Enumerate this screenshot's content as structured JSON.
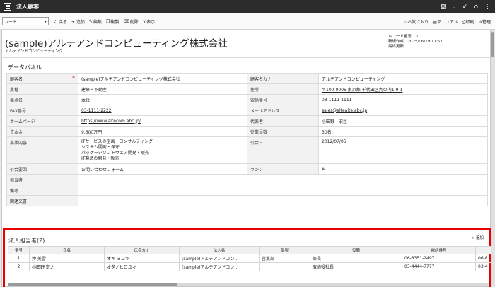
{
  "app": {
    "title": "法人顧客"
  },
  "top_icons": [
    "book-icon",
    "bell-icon",
    "check-icon",
    "home-icon",
    "more-icon"
  ],
  "toolbar": {
    "view_select": "カード",
    "back": "く 戻る",
    "add": "+ 追加",
    "edit": "編集",
    "copy": "複製",
    "delete": "削除",
    "show": "表示",
    "favorite": "お気に入り",
    "manual": "マニュアル",
    "print": "印刷",
    "admin": "管理"
  },
  "record": {
    "name": "(sample)アルテアンドコンピューティング株式会社",
    "kana": "アルテアンドコンピューティング",
    "meta_number": "レコード番号：3",
    "meta_created": "新規作成：2025/06/19 17:57",
    "meta_updated": "最終更新："
  },
  "panel": {
    "title": "データパネル",
    "rows": [
      [
        "顧客名",
        "(sample)アルテアンドコンピューティング株式会社",
        "顧客名カナ",
        "アルテアンドコンピューティング"
      ],
      [
        "業種",
        "建築・不動産",
        "住所",
        "〒100-0005 東京都 千代田区丸の内1-9-1"
      ],
      [
        "拠点名",
        "本社",
        "電話番号",
        "03-1111-1111"
      ],
      [
        "FAX番号",
        "03-1111-2222",
        "メールアドレス",
        "sales@altealte.abc.jp"
      ],
      [
        "ホームページ",
        "https://www.altecom.abc.jp/",
        "代表者",
        "小田野　宏之"
      ],
      [
        "資本金",
        "9,600万円",
        "従業員数",
        "30名"
      ],
      [
        "事業内容",
        "ITサービスの企画・コンサルティング\nシステム開発・保守\nパッケージソフトウェア開発・販売\nIT製品の開発・販売",
        "引合日",
        "2012/07/05"
      ],
      [
        "引合要因",
        "お問い合わせフォーム",
        "ランク",
        "A"
      ],
      [
        "担当者",
        "",
        "",
        ""
      ],
      [
        "備考",
        "",
        "",
        ""
      ],
      [
        "関連文書",
        "",
        "",
        ""
      ]
    ],
    "required_mark": "*"
  },
  "contacts": {
    "title": "法人担当者(2)",
    "add": "+ 追加",
    "headers": [
      "番号",
      "氏名",
      "氏名カナ",
      "法人名",
      "部署",
      "役職",
      "電話番号"
    ],
    "rows": [
      [
        "1",
        "沖 美雪",
        "オキ ミユキ",
        "(sample)アルテアンドコン…",
        "営業部",
        "部長",
        "06-8351-2497"
      ],
      [
        "2",
        "小田野 宏之",
        "オダノヒロユキ",
        "(sample)アルテアンドコン…",
        "",
        "取締役社長",
        "03-4444-7777"
      ]
    ],
    "extra": [
      "06-8",
      "03-4"
    ]
  }
}
